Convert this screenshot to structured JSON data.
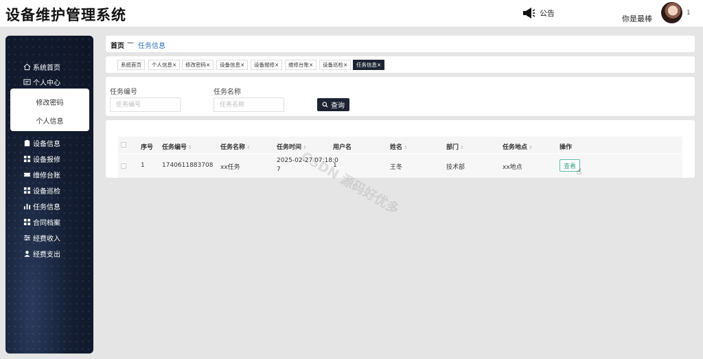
{
  "header": {
    "title": "设备维护管理系统",
    "notice_label": "公告",
    "username": "你是最棒",
    "avatar_badge": "1"
  },
  "sidebar": {
    "items": [
      {
        "label": "系统首页",
        "icon": "home-icon"
      },
      {
        "label": "个人中心",
        "icon": "id-card-icon"
      },
      {
        "label": "设备信息",
        "icon": "clipboard-icon"
      },
      {
        "label": "设备报修",
        "icon": "grid-icon"
      },
      {
        "label": "维修台账",
        "icon": "ticket-icon"
      },
      {
        "label": "设备巡检",
        "icon": "grid-icon"
      },
      {
        "label": "任务信息",
        "icon": "bar-chart-icon"
      },
      {
        "label": "合同档案",
        "icon": "grid-icon"
      },
      {
        "label": "经费收入",
        "icon": "sliders-icon"
      },
      {
        "label": "经费支出",
        "icon": "user-icon"
      }
    ],
    "submenu": [
      "修改密码",
      "个人信息"
    ]
  },
  "breadcrumb": {
    "home": "首页",
    "separator": "—",
    "current": "任务信息"
  },
  "tabs": [
    {
      "label": "系统首页",
      "closable": false
    },
    {
      "label": "个人信息",
      "closable": true
    },
    {
      "label": "修改密码",
      "closable": true
    },
    {
      "label": "设备信息",
      "closable": true
    },
    {
      "label": "设备报修",
      "closable": true
    },
    {
      "label": "维修台账",
      "closable": true
    },
    {
      "label": "设备巡检",
      "closable": true
    },
    {
      "label": "任务信息",
      "closable": true,
      "active": true
    }
  ],
  "search": {
    "task_no_label": "任务编号",
    "task_no_placeholder": "任务编号",
    "task_name_label": "任务名称",
    "task_name_placeholder": "任务名称",
    "query_button": "查询"
  },
  "table": {
    "columns": [
      "序号",
      "任务编号",
      "任务名称",
      "任务时间",
      "用户名",
      "姓名",
      "部门",
      "任务地点",
      "操作"
    ],
    "rows": [
      {
        "index": "1",
        "task_no": "1740611883708",
        "task_name": "xx任务",
        "task_time_line1": "2025-02-27 07:18:0",
        "task_time_line2": "7",
        "username": "1",
        "name": "王冬",
        "department": "技术部",
        "location": "xx地点",
        "action": "查看"
      }
    ]
  },
  "watermark": "CSDN 源码好优多",
  "colors": {
    "accent": "#1d2333",
    "link": "#2d6fb6",
    "view_button": "#3aa18a"
  }
}
